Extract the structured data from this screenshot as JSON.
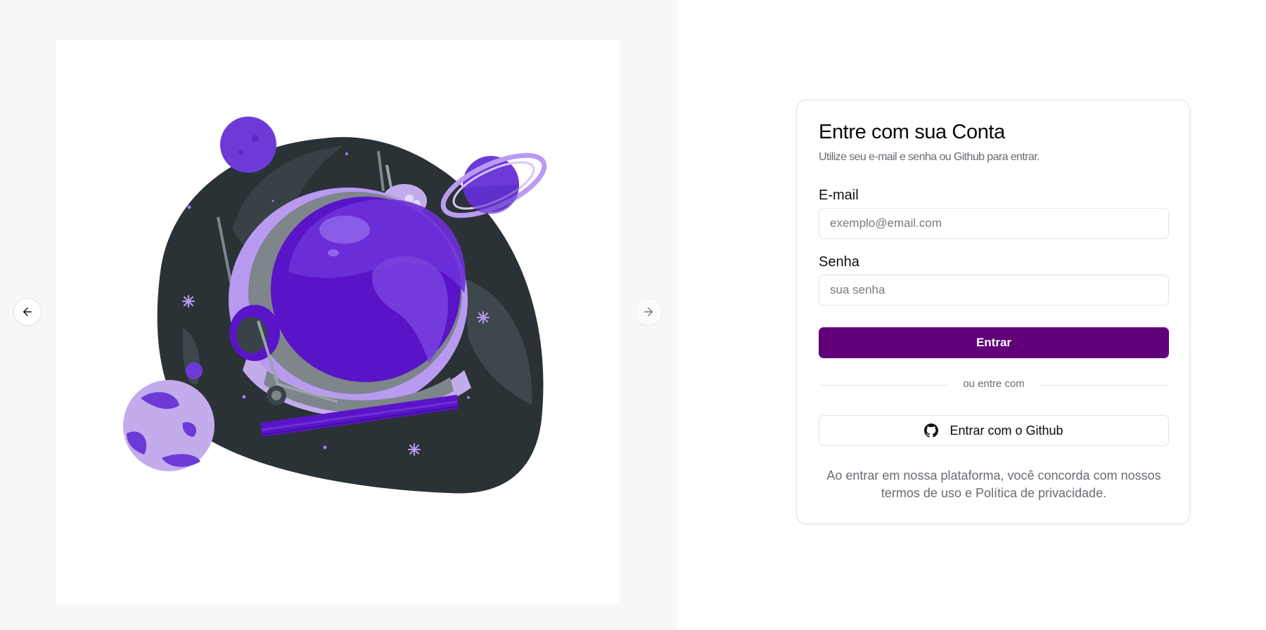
{
  "carousel": {
    "prev_icon": "arrow-left-icon",
    "next_icon": "arrow-right-icon"
  },
  "login": {
    "title": "Entre com sua Conta",
    "subtitle": "Utilize seu e-mail e senha ou Github para entrar.",
    "email_label": "E-mail",
    "email_placeholder": "exemplo@email.com",
    "email_value": "",
    "password_label": "Senha",
    "password_placeholder": "sua senha",
    "password_value": "",
    "submit_label": "Entrar",
    "divider_text": "ou entre com",
    "github_label": "Entrar com o Github",
    "github_icon": "github-icon",
    "terms_line1": "Ao entrar em nossa plataforma, você concorda com nossos",
    "terms_line2": "termos de uso e Política de privacidade."
  },
  "colors": {
    "accent": "#62007a",
    "illustration_purple": "#5a14c8",
    "illustration_dark": "#2b3236"
  }
}
